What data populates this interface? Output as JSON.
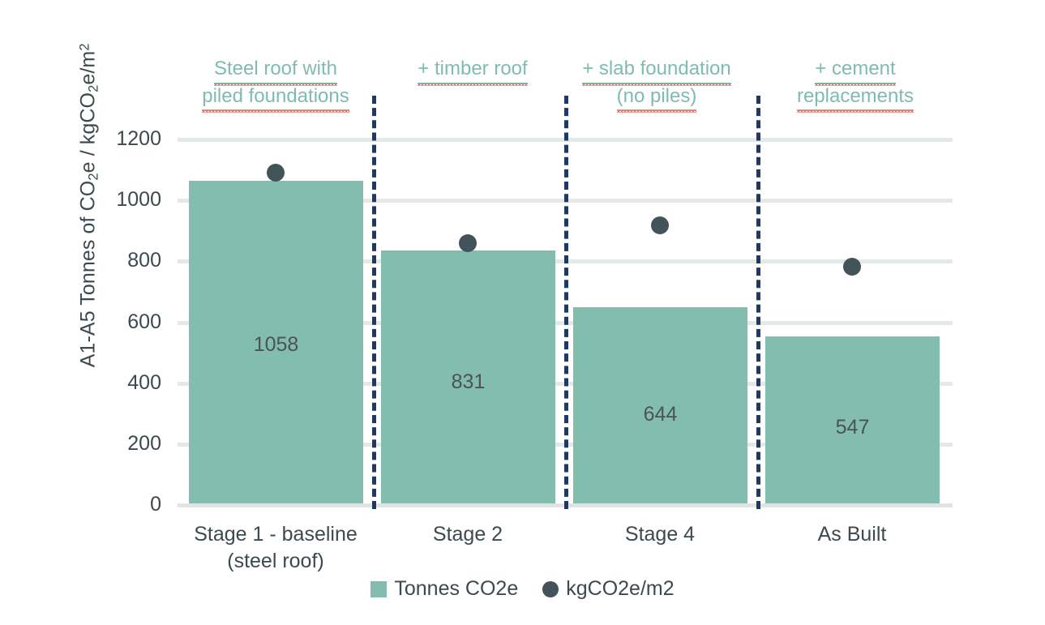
{
  "chart_data": {
    "type": "bar",
    "title": "",
    "xlabel": "",
    "ylabel": "A1-A5 Tonnes of CO2e / kgCO2e/m2",
    "ylim": [
      0,
      1200
    ],
    "yticks": [
      0,
      200,
      400,
      600,
      800,
      1000,
      1200
    ],
    "grid": true,
    "legend_position": "bottom",
    "categories": [
      "Stage 1 - baseline (steel roof)",
      "Stage 2",
      "Stage 4",
      "As Built"
    ],
    "series": [
      {
        "name": "Tonnes CO2e",
        "type": "bar",
        "color": "#82bdb0",
        "values": [
          1058,
          831,
          644,
          547
        ]
      },
      {
        "name": "kgCO2e/m2",
        "type": "scatter",
        "color": "#43535a",
        "values": [
          1085,
          850,
          913,
          777
        ]
      }
    ],
    "annotations": [
      "Steel roof with piled foundations",
      "+ timber roof",
      "+ slab foundation (no piles)",
      "+ cement replacements"
    ]
  },
  "axis": {
    "y_title_parts": {
      "prefix": "A1-A5 Tonnes of CO",
      "sub1": "2",
      "mid": "e / kgCO",
      "sub2": "2",
      "suffix": "e/m",
      "sup": "2"
    },
    "ticks": [
      "1200",
      "1000",
      "800",
      "600",
      "400",
      "200",
      "0"
    ]
  },
  "categories": [
    {
      "line1": "Stage 1 - baseline",
      "line2": "(steel roof)"
    },
    {
      "line1": "Stage 2",
      "line2": ""
    },
    {
      "line1": "Stage 4",
      "line2": ""
    },
    {
      "line1": "As Built",
      "line2": ""
    }
  ],
  "bars": [
    {
      "value": "1058"
    },
    {
      "value": "831"
    },
    {
      "value": "644"
    },
    {
      "value": "547"
    }
  ],
  "annotations": [
    {
      "line1": "Steel roof with",
      "line2": "piled foundations"
    },
    {
      "line1": "+ timber roof",
      "line2": ""
    },
    {
      "line1": "+ slab foundation",
      "line2": "(no piles)"
    },
    {
      "line1": "+ cement",
      "line2": "replacements"
    }
  ],
  "legend": {
    "items": [
      {
        "label": "Tonnes CO2e",
        "marker": "square",
        "color": "#82bdb0"
      },
      {
        "label": "kgCO2e/m2",
        "marker": "circle",
        "color": "#43535a"
      }
    ]
  },
  "colors": {
    "bar": "#82bdb0",
    "dot": "#43535a",
    "annotation": "#7fbcb0",
    "divider": "#1f3864",
    "grid": "#e3e8e8",
    "text": "#3c4a4f",
    "spellcheck": "#e8736a"
  }
}
